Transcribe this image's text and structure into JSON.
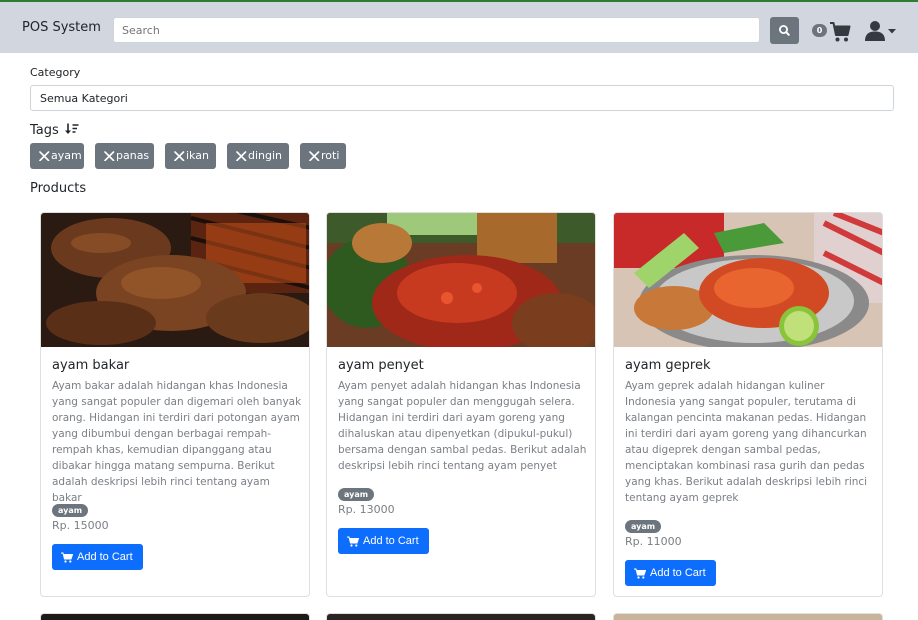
{
  "navbar": {
    "brand": "POS System",
    "search_placeholder": "Search",
    "cart_count": "0"
  },
  "filters": {
    "category_label": "Category",
    "category_value": "Semua Kategori",
    "tags_label": "Tags",
    "tags": [
      "ayam",
      "panas",
      "ikan",
      "dingin",
      "roti"
    ]
  },
  "products_label": "Products",
  "products": [
    {
      "name": "ayam bakar",
      "description": "Ayam bakar adalah hidangan khas Indonesia yang sangat populer dan digemari oleh banyak orang. Hidangan ini terdiri dari potongan ayam yang dibumbui dengan berbagai rempah-rempah khas, kemudian dipanggang atau dibakar hingga matang sempurna. Berikut adalah deskripsi lebih rinci tentang ayam bakar",
      "tag": "ayam",
      "price": "Rp. 15000",
      "button": "Add to Cart"
    },
    {
      "name": "ayam penyet",
      "description": "Ayam penyet adalah hidangan khas Indonesia yang sangat populer dan menggugah selera. Hidangan ini terdiri dari ayam goreng yang dihaluskan atau dipenyetkan (dipukul-pukul) bersama dengan sambal pedas. Berikut adalah deskripsi lebih rinci tentang ayam penyet",
      "tag": "ayam",
      "price": "Rp. 13000",
      "button": "Add to Cart"
    },
    {
      "name": "ayam geprek",
      "description": "Ayam geprek adalah hidangan kuliner Indonesia yang sangat populer, terutama di kalangan pencinta makanan pedas. Hidangan ini terdiri dari ayam goreng yang dihancurkan atau digeprek dengan sambal pedas, menciptakan kombinasi rasa gurih dan pedas yang khas. Berikut adalah deskripsi lebih rinci tentang ayam geprek",
      "tag": "ayam",
      "price": "Rp. 11000",
      "button": "Add to Cart"
    }
  ],
  "colors": {
    "navbar_bg": "#d2d6de",
    "primary": "#0d6efd",
    "secondary": "#6c757d"
  }
}
